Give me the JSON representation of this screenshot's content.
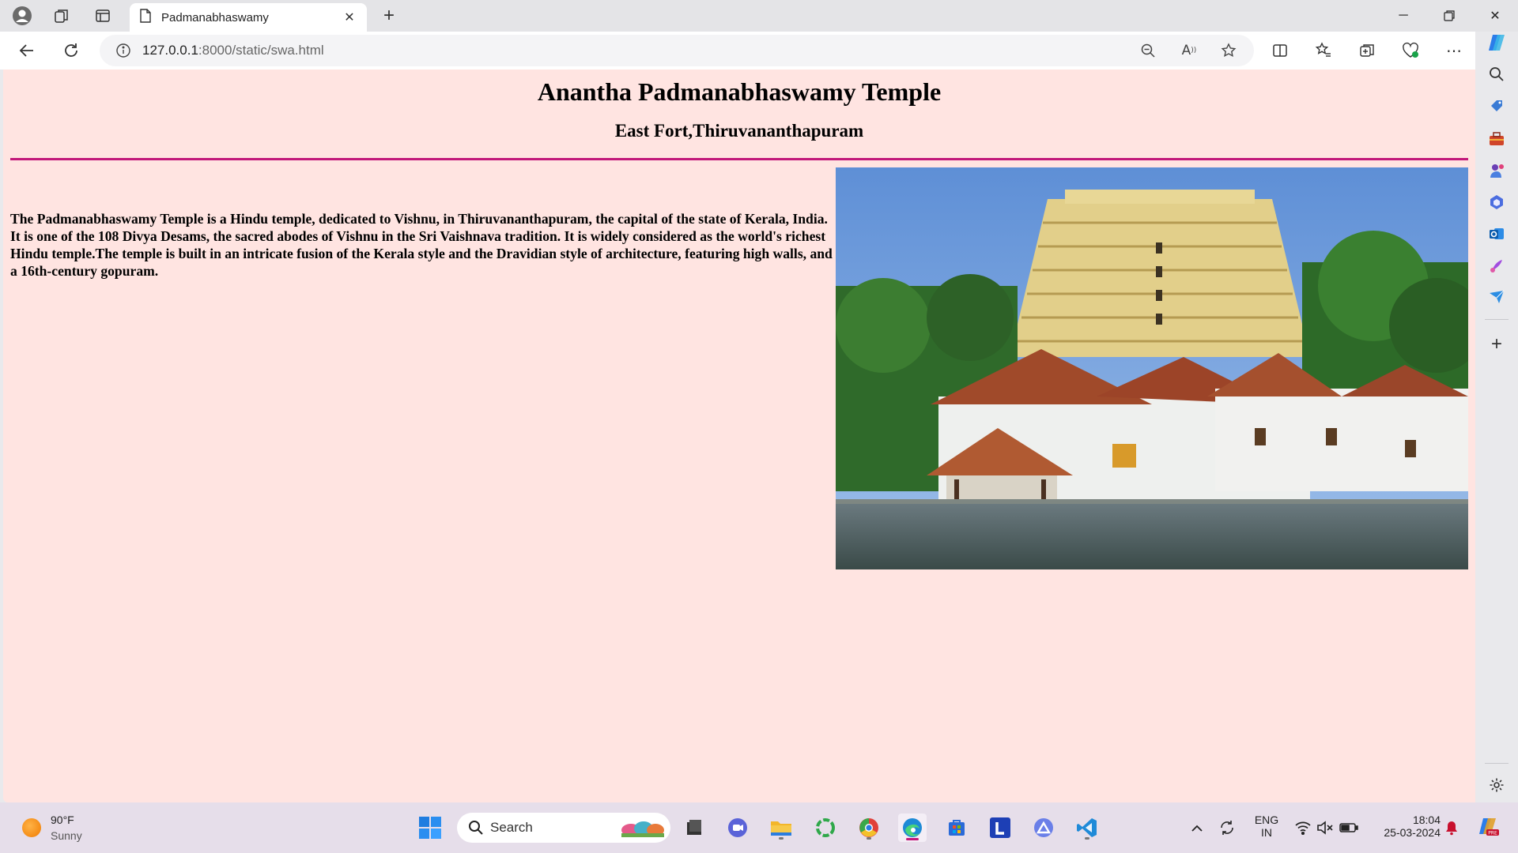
{
  "browser": {
    "tab": {
      "title": "Padmanabhaswamy"
    },
    "address": {
      "host": "127.0.0.1",
      "path": ":8000/static/swa.html"
    }
  },
  "page": {
    "title": "Anantha Padmanabhaswamy Temple",
    "subtitle": "East Fort,Thiruvananthapuram",
    "description": "The Padmanabhaswamy Temple is a Hindu temple, dedicated to Vishnu, in Thiruvananthapuram, the capital of the state of Kerala, India. It is one of the 108 Divya Desams, the sacred abodes of Vishnu in the Sri Vaishnava tradition. It is widely considered as the world's richest Hindu temple.The temple is built in an intricate fusion of the Kerala style and the Dravidian style of architecture, featuring high walls, and a 16th-century gopuram."
  },
  "colors": {
    "page_background": "#ffe4e1",
    "rule": "#c2187a",
    "titlebar": "#e4e4e7",
    "taskbar": "#e6deea"
  },
  "taskbar": {
    "weather": {
      "temp": "90°F",
      "condition": "Sunny"
    },
    "search": {
      "label": "Search"
    },
    "apps": [
      "start-icon",
      "file-explorer-icon",
      "teams-icon",
      "folder-icon",
      "ring-app-icon",
      "chrome-icon",
      "edge-icon",
      "store-icon",
      "l-app-icon",
      "triangle-app-icon",
      "vscode-icon"
    ],
    "tray": {
      "lang_line1": "ENG",
      "lang_line2": "IN",
      "time": "18:04",
      "date": "25-03-2024"
    }
  },
  "sidebar": {
    "icons": [
      "search-icon",
      "shopping-tag-icon",
      "toolbox-icon",
      "games-icon",
      "m365-icon",
      "outlook-icon",
      "designer-icon",
      "send-icon",
      "add-icon",
      "settings-icon"
    ]
  }
}
